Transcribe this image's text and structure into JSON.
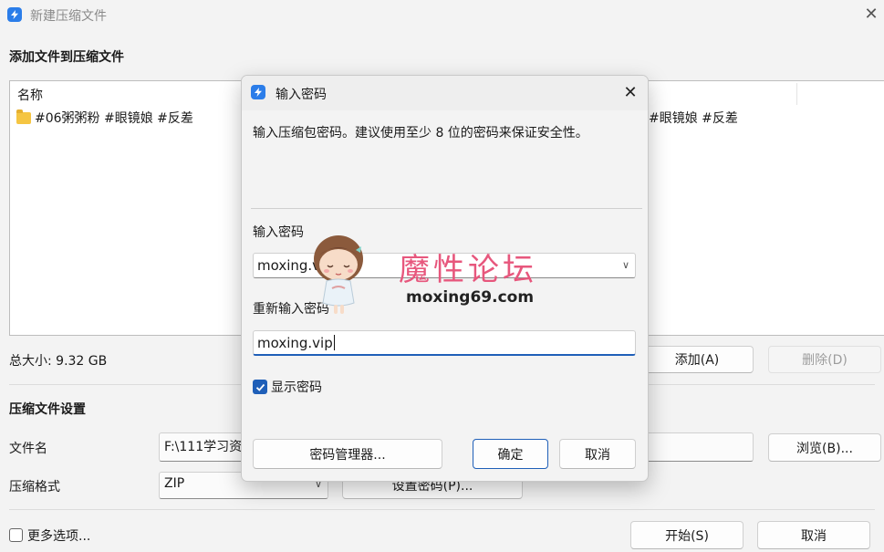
{
  "window": {
    "title": "新建压缩文件",
    "close_glyph": "✕"
  },
  "files_section": {
    "heading": "添加文件到压缩文件",
    "column_name": "名称",
    "file_name_left": "#06粥粥粉 #眼镜娘 #反差",
    "file_name_right": "#眼镜娘 #反差",
    "total_size": "总大小: 9.32 GB",
    "add_button": "添加(A)",
    "delete_button": "删除(D)"
  },
  "archive_settings": {
    "heading": "压缩文件设置",
    "filename_label": "文件名",
    "filename_value": "F:\\111学习资",
    "browse_button": "浏览(B)...",
    "format_label": "压缩格式",
    "format_value": "ZIP",
    "set_password_button": "设置密码(P)..."
  },
  "footer": {
    "more_options": "更多选项...",
    "start_button": "开始(S)",
    "cancel_button": "取消"
  },
  "dialog": {
    "title": "输入密码",
    "close_glyph": "✕",
    "description": "输入压缩包密码。建议使用至少 8 位的密码来保证安全性。",
    "password_label": "输入密码",
    "password_value": "moxing.vi",
    "reenter_label": "重新输入密码",
    "reenter_value": "moxing.vip",
    "show_password": "显示密码",
    "show_password_checked": true,
    "password_manager_button": "密码管理器...",
    "ok_button": "确定",
    "cancel_button": "取消"
  },
  "watermark": {
    "title": "魔性论坛",
    "url": "moxing69.com"
  },
  "colors": {
    "accent": "#1f5fb8",
    "app_icon": "#2b7de9",
    "watermark": "#e7577d",
    "folder": "#f5c542"
  },
  "icons": {
    "app": "bolt-icon",
    "folder": "folder-icon",
    "close": "close-icon",
    "dropdown": "chevron-down-icon",
    "checkbox_checked": "checkmark-icon"
  }
}
